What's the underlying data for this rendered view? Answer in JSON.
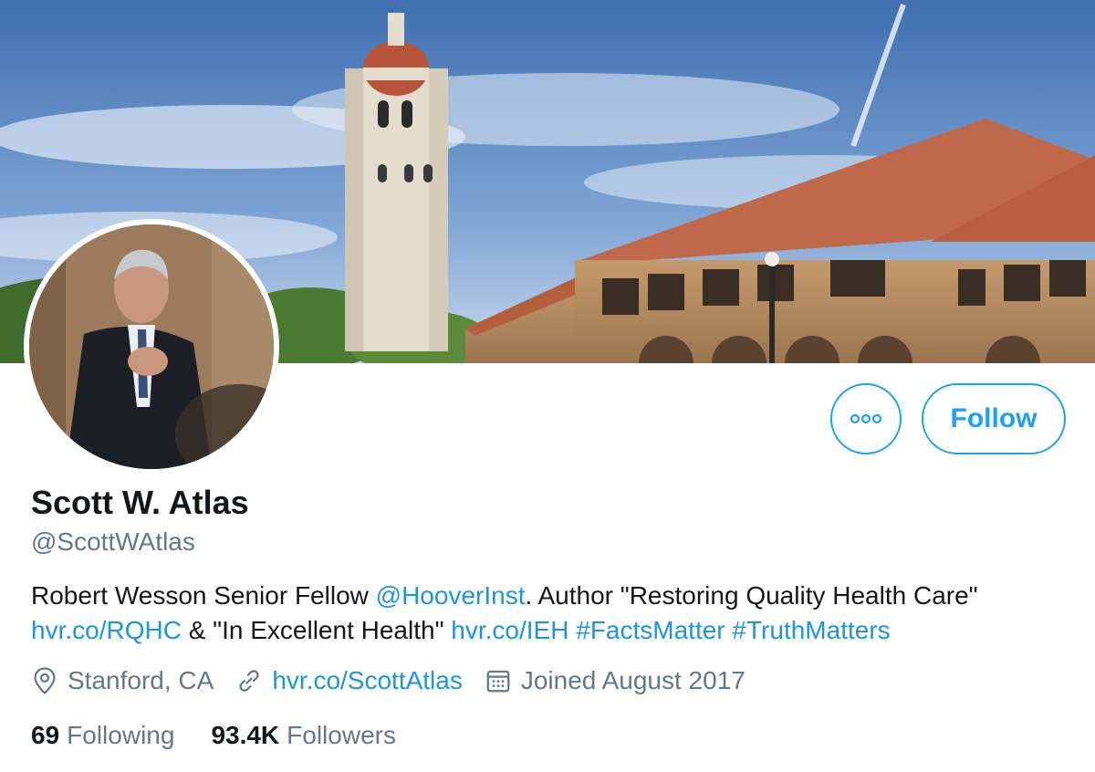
{
  "banner": {
    "description_icon": "campus-banner-image"
  },
  "profile": {
    "name": "Scott W. Atlas",
    "handle": "@ScottWAtlas",
    "bio": {
      "part1": "Robert Wesson Senior Fellow ",
      "mention": "@HooverInst",
      "part2": ". Author \"Restoring Quality Health Care\"",
      "link1": "hvr.co/RQHC",
      "part3": " & \"In Excellent Health\" ",
      "link2": "hvr.co/IEH",
      "hashtag1": "#FactsMatter",
      "hashtag2": "#TruthMatters"
    },
    "location": "Stanford, CA",
    "website": "hvr.co/ScottAtlas",
    "joined": "Joined August 2017"
  },
  "actions": {
    "follow_label": "Follow",
    "more_icon": "more-options-icon"
  },
  "stats": {
    "following_count": "69",
    "following_label": "Following",
    "followers_count": "93.4K",
    "followers_label": "Followers"
  },
  "colors": {
    "accent": "#1da1f2",
    "link": "#1b95e0",
    "secondary_text": "#657786",
    "primary_text": "#14171a"
  }
}
